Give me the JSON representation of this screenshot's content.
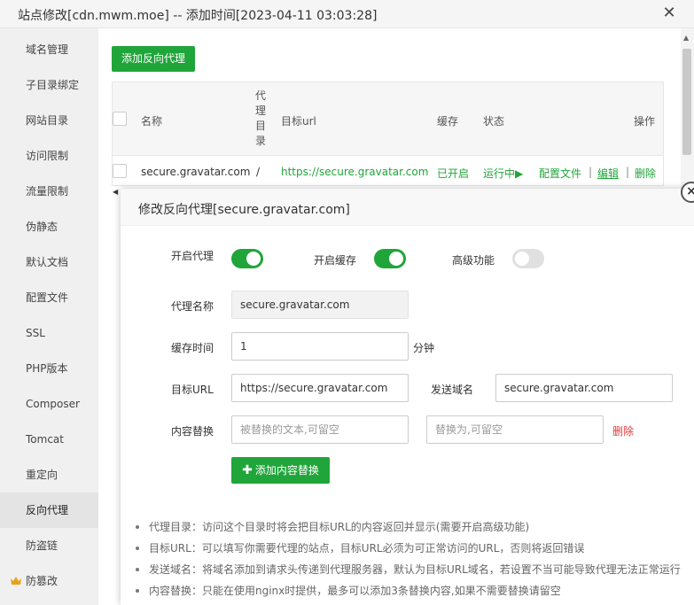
{
  "window": {
    "title": "站点修改[cdn.mwm.moe] -- 添加时间[2023-04-11 03:03:28]",
    "close": "✕"
  },
  "sidebar": {
    "items": [
      {
        "label": "域名管理"
      },
      {
        "label": "子目录绑定"
      },
      {
        "label": "网站目录"
      },
      {
        "label": "访问限制"
      },
      {
        "label": "流量限制"
      },
      {
        "label": "伪静态"
      },
      {
        "label": "默认文档"
      },
      {
        "label": "配置文件"
      },
      {
        "label": "SSL"
      },
      {
        "label": "PHP版本"
      },
      {
        "label": "Composer"
      },
      {
        "label": "Tomcat"
      },
      {
        "label": "重定向"
      },
      {
        "label": "反向代理",
        "active": true
      },
      {
        "label": "防盗链"
      },
      {
        "label": "防篡改",
        "icon": "crown-icon",
        "icon_color": "#e7a21a"
      }
    ]
  },
  "toolbar": {
    "add_proxy": "添加反向代理"
  },
  "table": {
    "headers": {
      "name": "名称",
      "proxy_dir": "代理目录",
      "target_url": "目标url",
      "cache": "缓存",
      "status": "状态",
      "actions": "操作"
    },
    "rows": [
      {
        "name": "secure.gravatar.com",
        "dir": "/",
        "target_url": "https://secure.gravatar.com",
        "cache": "已开启",
        "status": "运行中▶",
        "config": "配置文件",
        "edit": "编辑",
        "delete": "删除",
        "separator": "|"
      }
    ]
  },
  "modal": {
    "title": "修改反向代理[secure.gravatar.com]",
    "close": "×",
    "enable_proxy_label": "开启代理",
    "enable_proxy": true,
    "enable_cache_label": "开启缓存",
    "enable_cache": true,
    "advanced_label": "高级功能",
    "advanced": false,
    "proxy_name_label": "代理名称",
    "proxy_name": "secure.gravatar.com",
    "cache_time_label": "缓存时间",
    "cache_time": "1",
    "cache_time_unit": "分钟",
    "target_url_label": "目标URL",
    "target_url": "https://secure.gravatar.com",
    "send_domain_label": "发送域名",
    "send_domain": "secure.gravatar.com",
    "content_replace_label": "内容替换",
    "replace_from_placeholder": "被替换的文本,可留空",
    "replace_to_placeholder": "替换为,可留空",
    "delete_label": "删除",
    "add_content_replace": "添加内容替换",
    "notes": [
      "代理目录：访问这个目录时将会把目标URL的内容返回并显示(需要开启高级功能)",
      "目标URL：可以填写你需要代理的站点，目标URL必须为可正常访问的URL，否则将返回错误",
      "发送域名：将域名添加到请求头传递到代理服务器，默认为目标URL域名，若设置不当可能导致代理无法正常运行",
      "内容替换：只能在使用nginx时提供，最多可以添加3条替换内容,如果不需要替换请留空"
    ]
  }
}
